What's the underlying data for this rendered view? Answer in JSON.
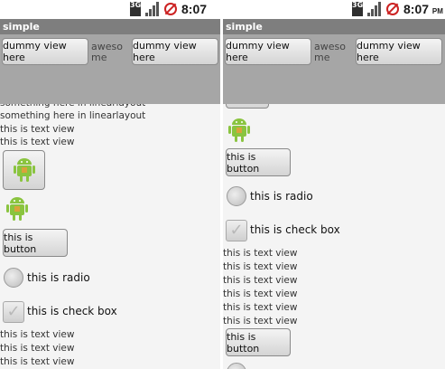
{
  "status": {
    "network": "3G",
    "time": "8:07",
    "ampm": "PM"
  },
  "app_title": "simple",
  "overlay": {
    "button_left": "dummy view here",
    "center_text": "awesome",
    "button_right": "dummy view here"
  },
  "left": {
    "linear_texts": [
      "something here in linearlayout",
      "something here in linearlayout"
    ],
    "text_views_top": [
      "this is text view",
      "this is text view"
    ],
    "button_label": "this is button",
    "radio_label": "this is radio",
    "checkbox_label": "this is check box",
    "text_views_bottom": [
      "this is text view",
      "this is text view",
      "this is text view"
    ]
  },
  "right": {
    "button_label": "this is button",
    "radio_label": "this is radio",
    "checkbox_label": "this is check box",
    "text_views": [
      "this is text view",
      "this is text view",
      "this is text view",
      "this is text view",
      "this is text view",
      "this is text view"
    ],
    "button_label_2": "this is button"
  }
}
